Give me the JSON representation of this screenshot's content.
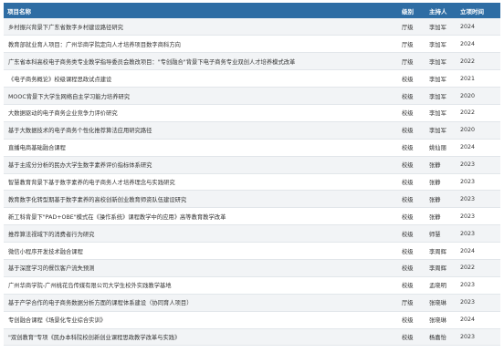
{
  "columns": {
    "name": "项目名称",
    "level": "级别",
    "host": "主持人",
    "year": "立项时间"
  },
  "rows": [
    {
      "name": "乡村振兴背景下广东省数字乡村建设路径研究",
      "level": "厅级",
      "host": "李加军",
      "year": "2024"
    },
    {
      "name": "教育部就业育人项目：广州华商学院定向人才培养项目数字商科方向",
      "level": "厅级",
      "host": "李加军",
      "year": "2024"
    },
    {
      "name": "广东省本科高校电子商务类专业教学指导委员会教改项目：\"专创融合\"背景下电子商务专业双创人才培养模式改革",
      "level": "厅级",
      "host": "李加军",
      "year": "2022"
    },
    {
      "name": "《电子商务概论》校级课程思政试点建设",
      "level": "校级",
      "host": "李加军",
      "year": "2021"
    },
    {
      "name": "MOOC背景下大学生网络自主学习能力培养研究",
      "level": "校级",
      "host": "李加军",
      "year": "2020"
    },
    {
      "name": "大数据驱动的电子商务企业竞争力评价研究",
      "level": "校级",
      "host": "李加军",
      "year": "2022"
    },
    {
      "name": "基于大数据技术的电子商务个性化推荐算法应用研究路径",
      "level": "校级",
      "host": "李加军",
      "year": "2020"
    },
    {
      "name": "直播电商基础融合课程",
      "level": "校级",
      "host": "姚仙丽",
      "year": "2024"
    },
    {
      "name": "基于主成分分析的民办大学生数字素养评价指标体系研究",
      "level": "校级",
      "host": "张静",
      "year": "2023"
    },
    {
      "name": "智慧教育背景下基于数字素养的电子商务人才培养理念与实践研究",
      "level": "校级",
      "host": "张静",
      "year": "2023"
    },
    {
      "name": "教育数字化转型期基于数字素养的高校创新创业教育师资队伍建设研究",
      "level": "校级",
      "host": "张静",
      "year": "2023"
    },
    {
      "name": "新工科背景下\"PAD+OBE\"模式在《操作系统》课程教学中的应用》高等教育教学改革",
      "level": "校级",
      "host": "张静",
      "year": "2023"
    },
    {
      "name": "推荐算法视域下的消费者行为研究",
      "level": "校级",
      "host": "师慧",
      "year": "2023"
    },
    {
      "name": "微信小程序开发技术融合课程",
      "level": "校级",
      "host": "李周辉",
      "year": "2024"
    },
    {
      "name": "基于深度学习的餐饮客户流失预测",
      "level": "校级",
      "host": "李周辉",
      "year": "2022"
    },
    {
      "name": "广州华商学院-广州桃花岛传媒有限公司大学生校外实践教学基地",
      "level": "校级",
      "host": "孟晓明",
      "year": "2023"
    },
    {
      "name": "基于产学合作的电子商务数据分析方面的课程体系建设（协同育人项目）",
      "level": "厅级",
      "host": "张晓琳",
      "year": "2023"
    },
    {
      "name": "专创融合课程《场景化专业综合实训》",
      "level": "校级",
      "host": "张晓琳",
      "year": "2024"
    },
    {
      "name": "\"双创教育\"专项《民办本科院校创新创业课程思政教学改革与实践》",
      "level": "校级",
      "host": "杨嘉怡",
      "year": "2023"
    }
  ]
}
